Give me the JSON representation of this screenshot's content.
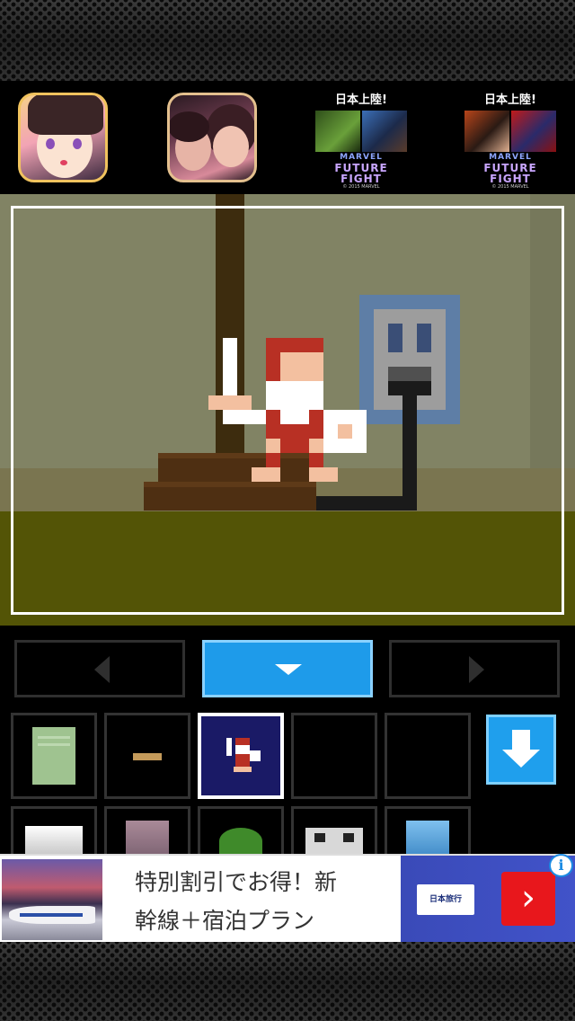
{
  "promo": {
    "apps": [
      {
        "name": "anime-girl-game"
      },
      {
        "name": "romance-game"
      },
      {
        "name": "marvel-future-fight-1",
        "banner": "日本上陸!",
        "logo_top": "MARVEL",
        "logo_main": "FUTURE",
        "logo_sub": "FIGHT",
        "copyright": "© 2015 MARVEL"
      },
      {
        "name": "marvel-future-fight-2",
        "banner": "日本上陸!",
        "logo_top": "MARVEL",
        "logo_main": "FUTURE",
        "logo_sub": "FIGHT",
        "copyright": "© 2015 MARVEL"
      }
    ]
  },
  "scene": {
    "wall_color": "#818364",
    "floor_color": "#535406",
    "frame_color": "#ffffff"
  },
  "nav": {
    "left_icon": "arrow-left-icon",
    "center_icon": "arrow-down-icon",
    "right_icon": "arrow-right-icon",
    "accent": "#1e9bea"
  },
  "inventory": {
    "items": [
      {
        "name": "green-note-item",
        "selected": false
      },
      {
        "name": "wooden-stick-item",
        "selected": false
      },
      {
        "name": "hero-figure-item",
        "selected": true
      },
      {
        "name": "empty-slot",
        "selected": false
      },
      {
        "name": "empty-slot",
        "selected": false
      },
      {
        "name": "white-box-item",
        "selected": false
      },
      {
        "name": "gray-box-item",
        "selected": false
      },
      {
        "name": "green-cap-item",
        "selected": false
      },
      {
        "name": "cassette-item",
        "selected": false
      },
      {
        "name": "blue-box-item",
        "selected": false
      }
    ],
    "scroll_icon": "download-arrow-icon"
  },
  "ad": {
    "line1": "特別割引でお得！新",
    "line2": "幹線＋宿泊プラン",
    "brand": "日本旅行",
    "cta_icon": "chevron-right-icon",
    "cta_glyph": "›",
    "info_glyph": "i"
  }
}
